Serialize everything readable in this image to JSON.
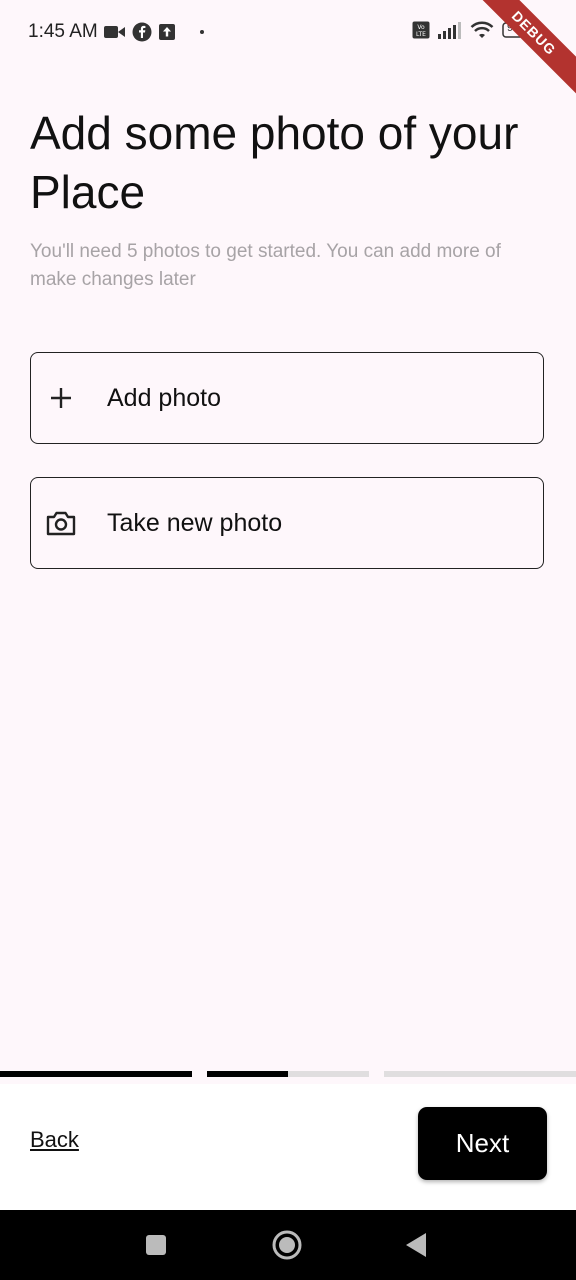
{
  "status_bar": {
    "time": "1:45 AM",
    "icons": [
      "video-icon",
      "facebook-icon",
      "upload-icon",
      "volte-icon",
      "signal-icon",
      "wifi-icon",
      "battery-icon"
    ],
    "battery": "96"
  },
  "debug_banner": "DEBUG",
  "header": {
    "title": "Add some photo of your Place",
    "subtitle": "You'll need 5 photos to get started. You can add more of make changes later"
  },
  "options": [
    {
      "label": "Add photo",
      "icon": "plus-icon"
    },
    {
      "label": "Take new photo",
      "icon": "camera-icon"
    }
  ],
  "progress": {
    "steps": 3,
    "current_step": 2,
    "current_step_fill": 0.5
  },
  "footer": {
    "back_label": "Back",
    "next_label": "Next"
  },
  "nav": [
    "recents-icon",
    "home-icon",
    "back-icon"
  ],
  "colors": {
    "background": "#fef7fb",
    "primary": "#000000",
    "subtitle": "#a7a3a6",
    "debug": "#b3332f"
  }
}
